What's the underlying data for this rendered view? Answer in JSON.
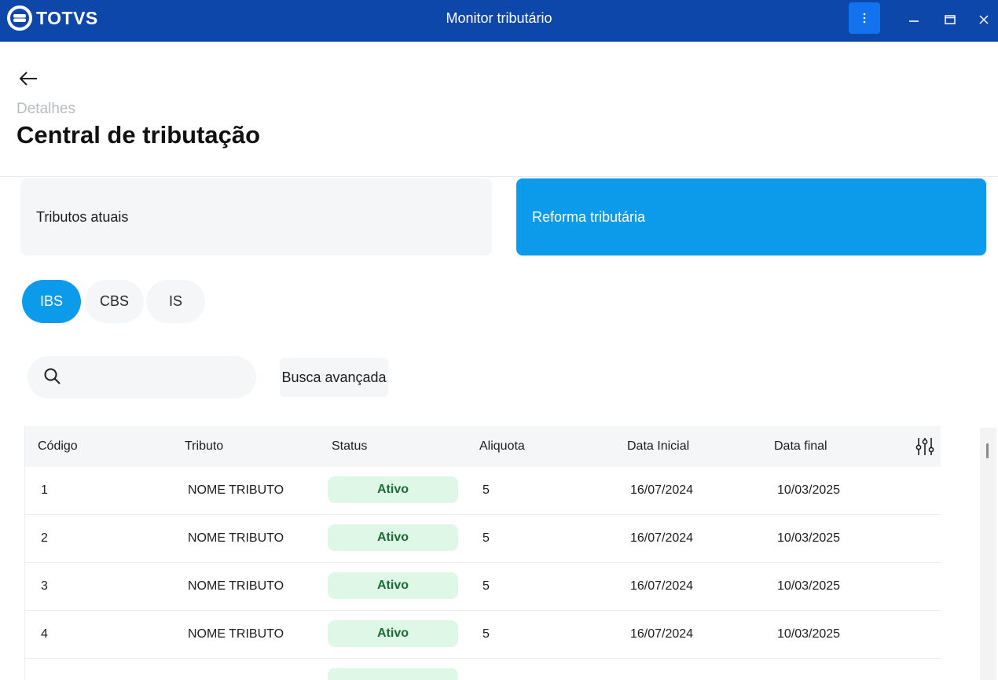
{
  "titlebar": {
    "brand": "TOTVS",
    "title": "Monitor tributário",
    "colors": {
      "bar": "#0d47a9",
      "menu_button": "#1372ee"
    },
    "icons": {
      "menu": "kebab-menu-icon",
      "minimize": "minimize-icon",
      "maximize": "maximize-icon",
      "close": "close-icon"
    }
  },
  "header": {
    "breadcrumb": "Detalhes",
    "title": "Central de tributação",
    "back_icon": "arrow-left-icon"
  },
  "cards": [
    {
      "label": "Tributos atuais",
      "active": false
    },
    {
      "label": "Reforma tributária",
      "active": true
    }
  ],
  "filters": [
    {
      "label": "IBS",
      "active": true
    },
    {
      "label": "CBS",
      "active": false
    },
    {
      "label": "IS",
      "active": false
    }
  ],
  "search": {
    "value": "",
    "icon": "search-icon",
    "advanced_label": "Busca avançada"
  },
  "table": {
    "columns": [
      "Código",
      "Tributo",
      "Status",
      "Aliquota",
      "Data Inicial",
      "Data final"
    ],
    "settings_icon": "column-settings-icon",
    "rows": [
      {
        "codigo": "1",
        "tributo": "NOME TRIBUTO",
        "status": "Ativo",
        "aliquota": "5",
        "data_inicial": "16/07/2024",
        "data_final": "10/03/2025"
      },
      {
        "codigo": "2",
        "tributo": "NOME TRIBUTO",
        "status": "Ativo",
        "aliquota": "5",
        "data_inicial": "16/07/2024",
        "data_final": "10/03/2025"
      },
      {
        "codigo": "3",
        "tributo": "NOME TRIBUTO",
        "status": "Ativo",
        "aliquota": "5",
        "data_inicial": "16/07/2024",
        "data_final": "10/03/2025"
      },
      {
        "codigo": "4",
        "tributo": "NOME TRIBUTO",
        "status": "Ativo",
        "aliquota": "5",
        "data_inicial": "16/07/2024",
        "data_final": "10/03/2025"
      },
      {
        "codigo": "",
        "tributo": "",
        "status": "",
        "aliquota": "",
        "data_inicial": "",
        "data_final": ""
      }
    ],
    "colors": {
      "accent": "#0c9aea",
      "badge_bg": "#def7e6",
      "badge_text": "#1d6b36"
    }
  }
}
